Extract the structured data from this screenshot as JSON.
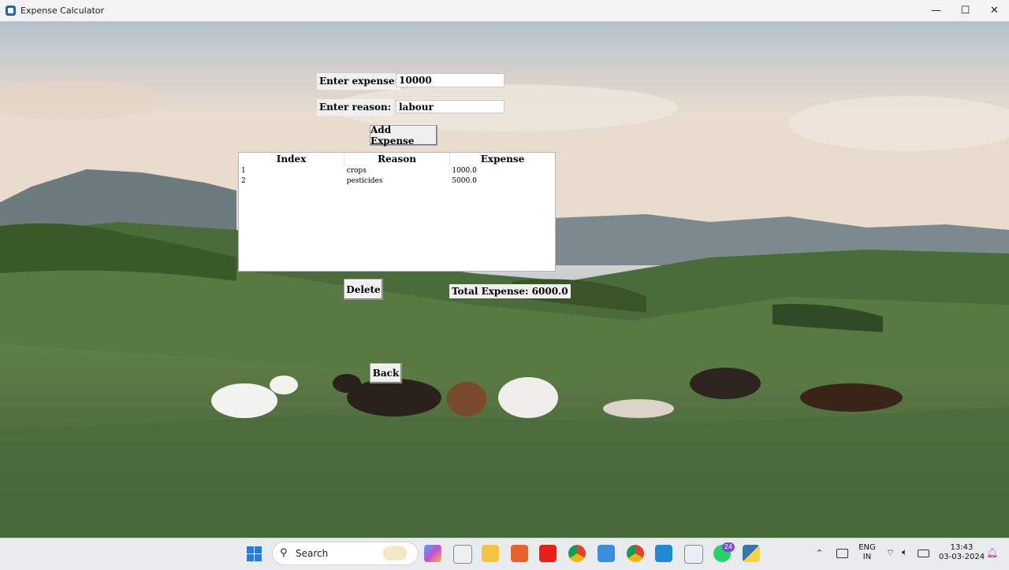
{
  "window": {
    "title": "Expense Calculator",
    "minimize": "—",
    "maximize": "☐",
    "close": "✕"
  },
  "form": {
    "expense_label": "Enter expense:",
    "expense_value": "10000",
    "reason_label": "Enter reason:",
    "reason_value": "labour",
    "add_button": "Add Expense"
  },
  "table": {
    "columns": [
      "Index",
      "Reason",
      "Expense"
    ],
    "rows": [
      [
        "1",
        "crops",
        "1000.0"
      ],
      [
        "2",
        "pesticides",
        "5000.0"
      ]
    ]
  },
  "actions": {
    "delete_button": "Delete",
    "back_button": "Back"
  },
  "total": "Total Expense: 6000.0",
  "taskbar": {
    "search_label": "Search",
    "lang_top": "ENG",
    "lang_bottom": "IN",
    "time": "13:43",
    "date": "03-03-2024",
    "whatsapp_badge": "24"
  }
}
